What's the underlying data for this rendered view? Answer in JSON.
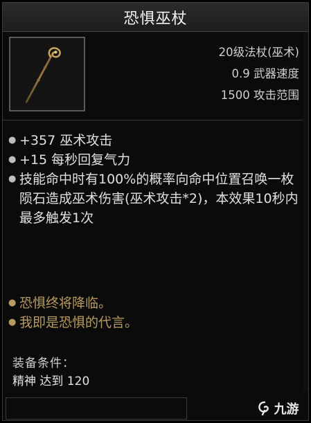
{
  "item": {
    "name": "恐惧巫杖",
    "icon": "staff-icon",
    "stats": [
      "20级法杖(巫术)",
      "0.9 武器速度",
      "1500 攻击范围"
    ],
    "affixes": [
      "+357 巫术攻击",
      "+15 每秒回复气力",
      "技能命中时有100%的概率向命中位置召唤一枚陨石造成巫术伤害(巫术攻击*2)，本效果10秒内最多触发1次"
    ],
    "flavor": [
      "恐惧终将降临。",
      "我即是恐惧的代言。"
    ],
    "requirements": {
      "title": "装备条件：",
      "line": "精神 达到 120"
    }
  },
  "watermark": {
    "text": "九游",
    "logo": "jiuyou-logo"
  },
  "colors": {
    "flavor": "#b79b5e",
    "background": "#0b0b0b"
  }
}
